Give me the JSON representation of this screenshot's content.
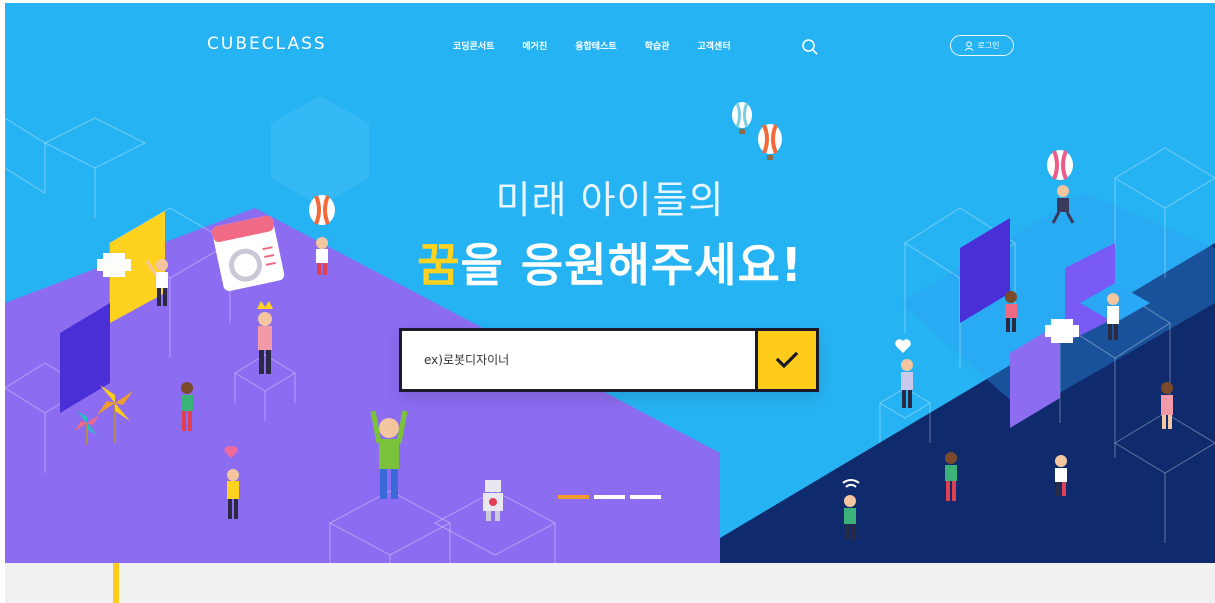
{
  "header": {
    "brand": "CUBECLASS",
    "nav": [
      "코딩콘서트",
      "메거진",
      "융합테스트",
      "학습관",
      "고객센터"
    ],
    "login_label": "로그인"
  },
  "hero": {
    "headline_line1": "미래 아이들의",
    "headline_accent": "꿈",
    "headline_rest": "을 응원해주세요!",
    "search_placeholder": "ex)로봇디자이너"
  },
  "pager": {
    "count": 3,
    "active_index": 0
  },
  "colors": {
    "sky": "#26b3f3",
    "purple": "#8c6cf1",
    "navy": "#0f2a6d",
    "accent_yellow": "#ffcc1c",
    "pager_active": "#f29d2b",
    "lower_band": "#f1f1f1"
  }
}
